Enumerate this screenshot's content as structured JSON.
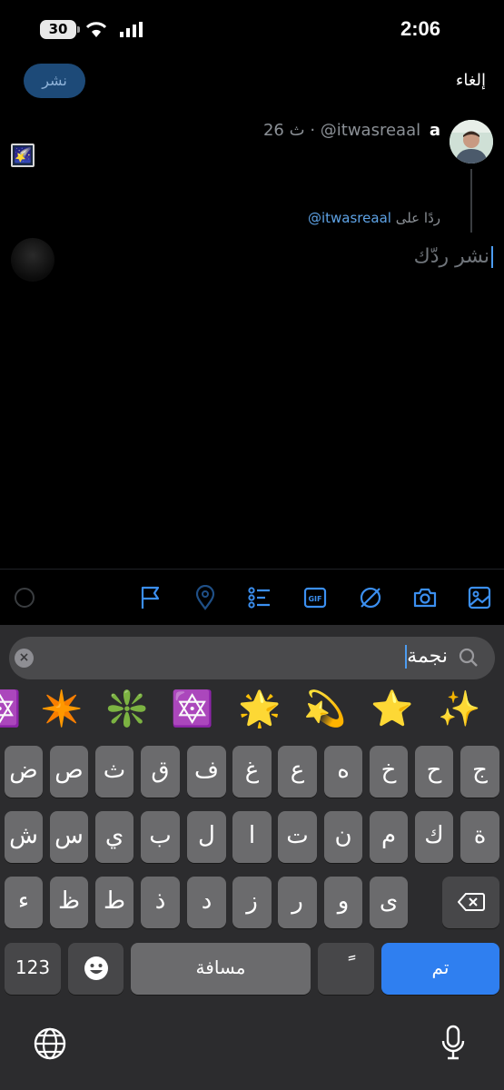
{
  "status_bar": {
    "battery": "30",
    "time": "2:06"
  },
  "header": {
    "post_label": "نشر",
    "cancel_label": "إلغاء"
  },
  "tweet": {
    "name": "a",
    "handle": "@itwasreaal",
    "time": "26 ث",
    "content_emoji": "🌠",
    "reply_prefix": "ردًا على",
    "reply_mention": "@itwasreaal"
  },
  "composer": {
    "placeholder": "نشر ردّك"
  },
  "toolbar": {
    "icons": [
      "image-icon",
      "camera-icon",
      "grok-icon",
      "gif-icon",
      "poll-icon",
      "location-icon",
      "flag-icon"
    ]
  },
  "keyboard": {
    "search_text": "نجمة",
    "emojis": [
      "✨",
      "⭐",
      "💫",
      "🌟",
      "🔯",
      "❇️",
      "✴️",
      "🔯"
    ],
    "row1": [
      "ض",
      "ص",
      "ث",
      "ق",
      "ف",
      "غ",
      "ع",
      "ه",
      "خ",
      "ح",
      "ج"
    ],
    "row2": [
      "ش",
      "س",
      "ي",
      "ب",
      "ل",
      "ا",
      "ت",
      "ن",
      "م",
      "ك",
      "ة"
    ],
    "row3": [
      "ء",
      "ظ",
      "ط",
      "ذ",
      "د",
      "ز",
      "ر",
      "و",
      "ى"
    ],
    "numbers_label": "123",
    "space_label": "مسافة",
    "tanween_label": "ً",
    "done_label": "تم"
  },
  "colors": {
    "accent": "#2f7ff0",
    "post_button": "#1d4a78",
    "mention": "#5ea3e6"
  }
}
